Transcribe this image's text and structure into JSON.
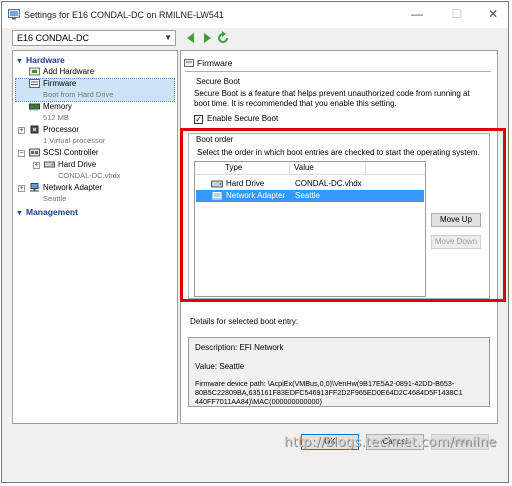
{
  "window": {
    "title": "Settings for E16 CONDAL-DC on RMILNE-LW541",
    "controls": {
      "minimize": "—",
      "maximize": "☐",
      "close": "✕"
    }
  },
  "toolbar": {
    "vm_selected": "E16 CONDAL-DC",
    "back_icon": "arrow-left-icon",
    "forward_icon": "arrow-right-icon",
    "refresh_icon": "refresh-icon"
  },
  "sidebar": {
    "hardware_label": "Hardware",
    "management_label": "Management",
    "items": [
      {
        "label": "Add Hardware",
        "sub": ""
      },
      {
        "label": "Firmware",
        "sub": "Boot from Hard Drive"
      },
      {
        "label": "Memory",
        "sub": "512 MB"
      },
      {
        "label": "Processor",
        "sub": "1 Virtual processor"
      },
      {
        "label": "SCSI Controller",
        "sub": ""
      },
      {
        "label": "Hard Drive",
        "sub": "CONDAL-DC.vhdx"
      },
      {
        "label": "Network Adapter",
        "sub": "Seattle"
      }
    ]
  },
  "firmware": {
    "title": "Firmware",
    "secure_boot": {
      "label": "Secure Boot",
      "description_line1": "Secure Boot is a feature that helps prevent unauthorized code from running at",
      "description_line2": "boot time. It is recommended that you enable this setting.",
      "checkbox_label": "Enable Secure Boot",
      "checked": true
    },
    "boot_order": {
      "label": "Boot order",
      "instruction": "Select the order in which boot entries are checked to start the operating system.",
      "columns": [
        "Type",
        "Value"
      ],
      "rows": [
        {
          "type": "Hard Drive",
          "value": "CONDAL-DC.vhdx",
          "selected": false
        },
        {
          "type": "Network Adapter",
          "value": "Seattle",
          "selected": true
        }
      ],
      "move_up": "Move Up",
      "move_down": "Move Down"
    },
    "details": {
      "label": "Details for selected boot entry:",
      "description": "Description: EFI Network",
      "value": "Value: Seattle",
      "path_line1": "Firmware device path: \\AcpiEx(VMBus,0,0)\\VenHw(9B17E5A2-0891-42DD-B653-",
      "path_line2": "80B5C22809BA,635161F83EDFC546913FF2D2F965ED0E64D2C4684D5F1438C1",
      "path_line3": "440FF7011AA84)\\MAC(000000000000)"
    }
  },
  "footer": {
    "ok": "OK",
    "cancel": "Cancel",
    "apply": "Apply"
  },
  "watermark": "http://blogs.technet.com/rmilne",
  "colors": {
    "highlight_box": "#e00000",
    "selection": "#3399ff",
    "section_head": "#1a3f8a"
  }
}
